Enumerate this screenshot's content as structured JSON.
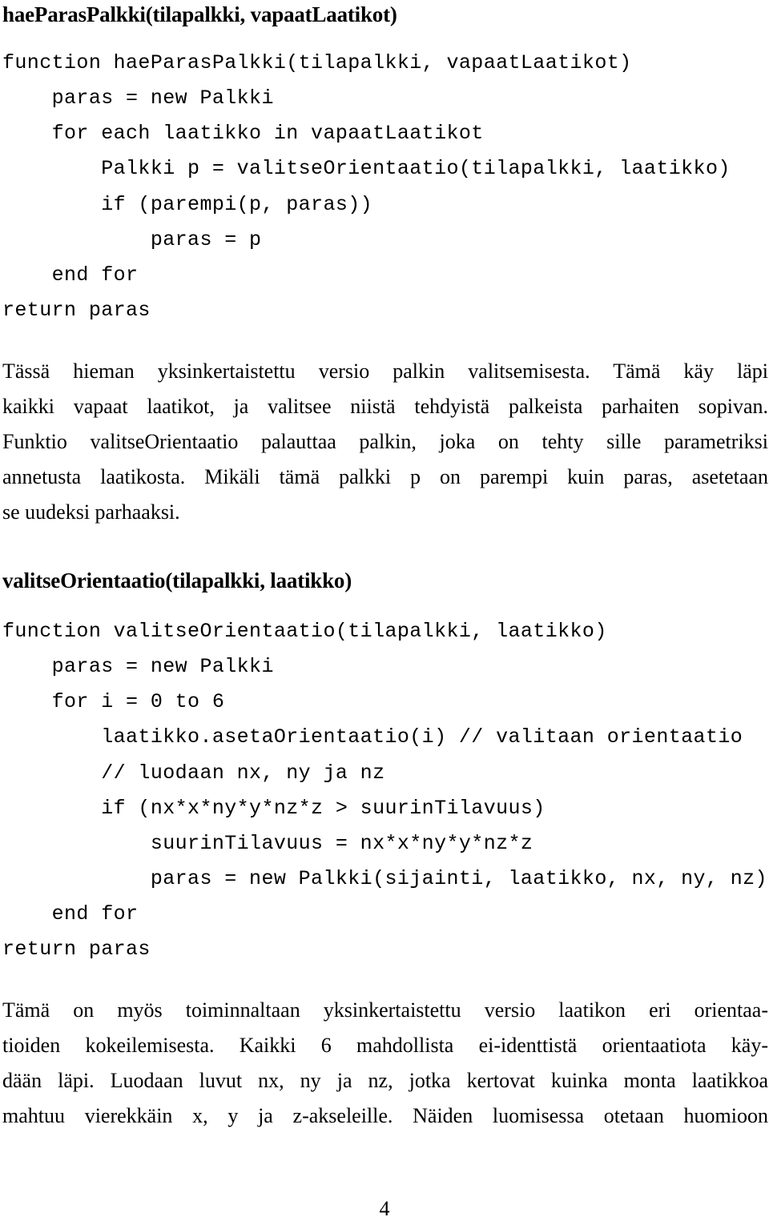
{
  "sections": [
    {
      "heading": "haeParasPalkki(tilapalkki, vapaatLaatikot)",
      "code": [
        "function haeParasPalkki(tilapalkki, vapaatLaatikot)",
        "    paras = new Palkki",
        "    for each laatikko in vapaatLaatikot",
        "        Palkki p = valitseOrientaatio(tilapalkki, laatikko)",
        "        if (parempi(p, paras))",
        "            paras = p",
        "    end for",
        "return paras"
      ],
      "paragraph": [
        "Tässä hieman yksinkertaistettu versio palkin valitsemisesta. Tämä käy läpi",
        "kaikki vapaat laatikot, ja valitsee niistä tehdyistä palkeista parhaiten sopivan.",
        "Funktio valitseOrientaatio palauttaa palkin, joka on tehty sille parametriksi",
        "annetusta laatikosta. Mikäli tämä palkki p on parempi kuin paras, asetetaan",
        "se uudeksi parhaaksi."
      ]
    },
    {
      "heading": "valitseOrientaatio(tilapalkki, laatikko)",
      "code": [
        "function valitseOrientaatio(tilapalkki, laatikko)",
        "    paras = new Palkki",
        "    for i = 0 to 6",
        "        laatikko.asetaOrientaatio(i) // valitaan orientaatio",
        "        // luodaan nx, ny ja nz",
        "        if (nx*x*ny*y*nz*z > suurinTilavuus)",
        "            suurinTilavuus = nx*x*ny*y*nz*z",
        "            paras = new Palkki(sijainti, laatikko, nx, ny, nz)",
        "    end for",
        "return paras"
      ],
      "paragraph": [
        "Tämä on myös toiminnaltaan yksinkertaistettu versio laatikon eri orientaa-",
        "tioiden kokeilemisesta. Kaikki 6 mahdollista ei-identtistä orientaatiota käy-",
        "dään läpi. Luodaan luvut nx, ny ja nz, jotka kertovat kuinka monta laatikkoa",
        "mahtuu vierekkäin x, y ja z-akseleille. Näiden luomisessa otetaan huomioon"
      ]
    }
  ],
  "page_number": "4"
}
